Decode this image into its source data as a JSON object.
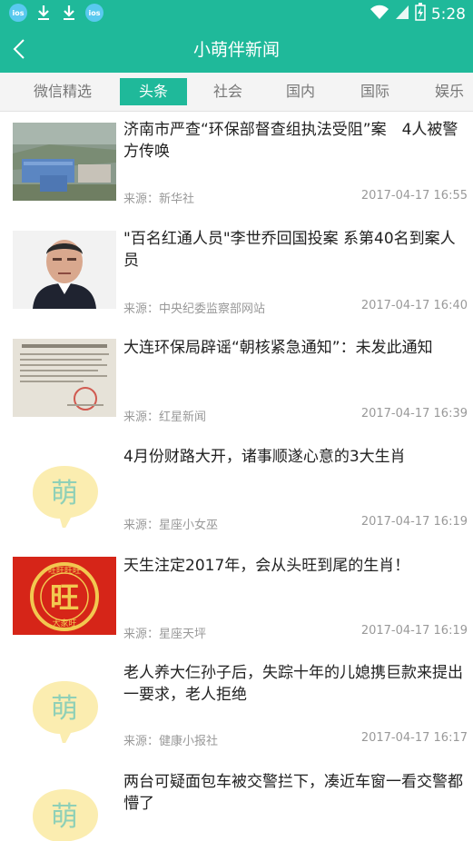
{
  "status_bar": {
    "time": "5:28",
    "left_icons": [
      "app-badge-icon",
      "download-icon",
      "download-icon",
      "app-badge-icon"
    ],
    "badge_text": "ios",
    "right_icons": [
      "wifi-icon",
      "signal-icon",
      "battery-icon"
    ]
  },
  "app": {
    "title": "小萌伴新闻",
    "accent": "#1fb99a"
  },
  "tabs": [
    {
      "label": "微信精选",
      "active": false
    },
    {
      "label": "头条",
      "active": true
    },
    {
      "label": "社会",
      "active": false
    },
    {
      "label": "国内",
      "active": false
    },
    {
      "label": "国际",
      "active": false
    },
    {
      "label": "娱乐",
      "active": false
    }
  ],
  "news": [
    {
      "title": "济南市严查“环保部督查组执法受阻”案　4人被警方传唤",
      "source": "来源：新华社",
      "time": "2017-04-17 16:55",
      "thumb": "aerial-factory-photo"
    },
    {
      "title": "\"百名红通人员\"李世乔回国投案 系第40名到案人员",
      "source": "来源：中央纪委监察部网站",
      "time": "2017-04-17 16:40",
      "thumb": "portrait-photo"
    },
    {
      "title": "大连环保局辟谣“朝核紧急通知”：未发此通知",
      "source": "来源：红星新闻",
      "time": "2017-04-17 16:39",
      "thumb": "document-photo"
    },
    {
      "title": "4月份财路大开，诸事顺遂心意的3大生肖",
      "source": "来源：星座小女巫",
      "time": "2017-04-17 16:19",
      "thumb": "meng-placeholder"
    },
    {
      "title": "天生注定2017年，会从头旺到尾的生肖！",
      "source": "来源：星座天坪",
      "time": "2017-04-17 16:19",
      "thumb": "wang-seal-image"
    },
    {
      "title": "老人养大仨孙子后，失踪十年的儿媳携巨款来提出一要求，老人拒绝",
      "source": "来源：健康小报社",
      "time": "2017-04-17 16:17",
      "thumb": "meng-placeholder"
    },
    {
      "title": "两台可疑面包车被交警拦下，凑近车窗一看交警都懵了",
      "source": "",
      "time": "",
      "thumb": "meng-placeholder"
    }
  ],
  "placeholder_glyph": "萌",
  "wang_seal": {
    "top": "旺旺旺旺",
    "center": "旺",
    "bottom": "大家旺"
  }
}
